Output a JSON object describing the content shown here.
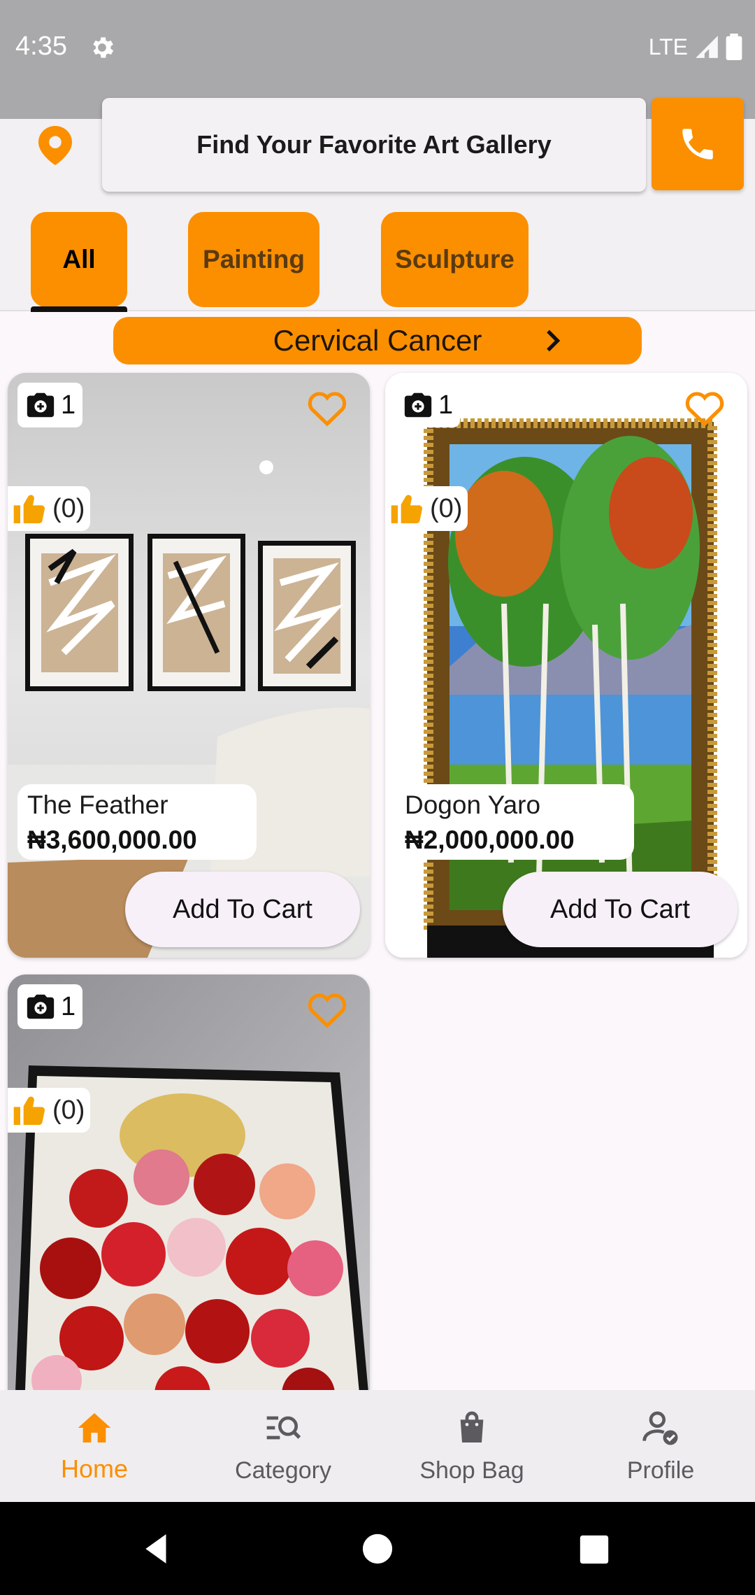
{
  "status_bar": {
    "time": "4:35",
    "network": "LTE"
  },
  "header": {
    "search_title": "Find Your Favorite Art Gallery",
    "location_icon": "map-pin-icon",
    "call_icon": "phone-icon"
  },
  "tabs": [
    {
      "label": "All",
      "active": true
    },
    {
      "label": "Painting",
      "active": false
    },
    {
      "label": "Sculpture",
      "active": false
    }
  ],
  "banner": {
    "label": "Cervical Cancer"
  },
  "products": [
    {
      "title": "The Feather",
      "price": "₦3,600,000.00",
      "photo_count": "1",
      "likes": "(0)",
      "cart_label": "Add To Cart"
    },
    {
      "title": "Dogon Yaro",
      "price": "₦2,000,000.00",
      "photo_count": "1",
      "likes": "(0)",
      "cart_label": "Add To Cart"
    },
    {
      "title": "",
      "price": "",
      "photo_count": "1",
      "likes": "(0)",
      "cart_label": ""
    }
  ],
  "bottom_nav": [
    {
      "label": "Home",
      "icon": "home-icon",
      "active": true
    },
    {
      "label": "Category",
      "icon": "category-search-icon",
      "active": false
    },
    {
      "label": "Shop Bag",
      "icon": "shopping-bag-icon",
      "active": false
    },
    {
      "label": "Profile",
      "icon": "profile-check-icon",
      "active": false
    }
  ],
  "colors": {
    "accent": "#fb8f00",
    "status_bar": "#a9a8aa",
    "nav_background": "#efedf0"
  }
}
